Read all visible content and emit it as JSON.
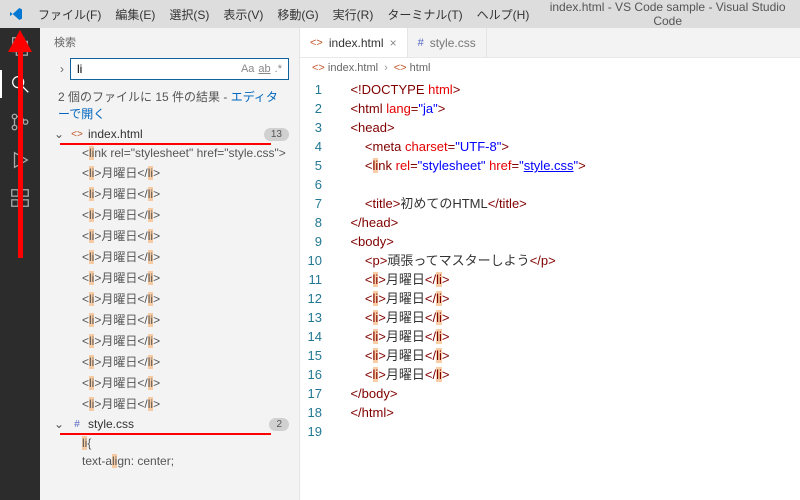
{
  "titlebar": {
    "menus": [
      "ファイル(F)",
      "編集(E)",
      "選択(S)",
      "表示(V)",
      "移動(G)",
      "実行(R)",
      "ターミナル(T)",
      "ヘルプ(H)"
    ],
    "title": "index.html - VS Code sample - Visual Studio Code"
  },
  "sidebar": {
    "header": "検索",
    "search_value": "li",
    "search_opts": {
      "case": "Aa",
      "word": "ab",
      "regex": ".*"
    },
    "summary_prefix": "2 個のファイルに 15 件の結果 - ",
    "summary_link": "エディターで開く",
    "files": [
      {
        "name": "index.html",
        "icon": "<>",
        "icon_class": "fic-html",
        "count": "13",
        "lines": [
          [
            [
              "<"
            ],
            [
              "li",
              true
            ],
            [
              "nk rel=\"stylesheet\" href=\"style.css\">"
            ]
          ],
          [
            [
              "<"
            ],
            [
              "li",
              true
            ],
            [
              ">月曜日</"
            ],
            [
              "li",
              true
            ],
            [
              ">"
            ]
          ],
          [
            [
              "<"
            ],
            [
              "li",
              true
            ],
            [
              ">月曜日</"
            ],
            [
              "li",
              true
            ],
            [
              ">"
            ]
          ],
          [
            [
              "<"
            ],
            [
              "li",
              true
            ],
            [
              ">月曜日</"
            ],
            [
              "li",
              true
            ],
            [
              ">"
            ]
          ],
          [
            [
              "<"
            ],
            [
              "li",
              true
            ],
            [
              ">月曜日</"
            ],
            [
              "li",
              true
            ],
            [
              ">"
            ]
          ],
          [
            [
              "<"
            ],
            [
              "li",
              true
            ],
            [
              ">月曜日</"
            ],
            [
              "li",
              true
            ],
            [
              ">"
            ]
          ],
          [
            [
              "<"
            ],
            [
              "li",
              true
            ],
            [
              ">月曜日</"
            ],
            [
              "li",
              true
            ],
            [
              ">"
            ]
          ],
          [
            [
              "<"
            ],
            [
              "li",
              true
            ],
            [
              ">月曜日</"
            ],
            [
              "li",
              true
            ],
            [
              ">"
            ]
          ],
          [
            [
              "<"
            ],
            [
              "li",
              true
            ],
            [
              ">月曜日</"
            ],
            [
              "li",
              true
            ],
            [
              ">"
            ]
          ],
          [
            [
              "<"
            ],
            [
              "li",
              true
            ],
            [
              ">月曜日</"
            ],
            [
              "li",
              true
            ],
            [
              ">"
            ]
          ],
          [
            [
              "<"
            ],
            [
              "li",
              true
            ],
            [
              ">月曜日</"
            ],
            [
              "li",
              true
            ],
            [
              ">"
            ]
          ],
          [
            [
              "<"
            ],
            [
              "li",
              true
            ],
            [
              ">月曜日</"
            ],
            [
              "li",
              true
            ],
            [
              ">"
            ]
          ],
          [
            [
              "<"
            ],
            [
              "li",
              true
            ],
            [
              ">月曜日</"
            ],
            [
              "li",
              true
            ],
            [
              ">"
            ]
          ]
        ]
      },
      {
        "name": "style.css",
        "icon": "#",
        "icon_class": "fic-css",
        "count": "2",
        "lines": [
          [
            [
              "li",
              true
            ],
            [
              "{"
            ]
          ],
          [
            [
              "text-a"
            ],
            [
              "li",
              true
            ],
            [
              "gn: center;"
            ]
          ]
        ]
      }
    ]
  },
  "editor": {
    "tabs": [
      {
        "icon": "<>",
        "icon_class": "fic-html",
        "label": "index.html",
        "active": true,
        "close": "×"
      },
      {
        "icon": "#",
        "icon_class": "fic-css",
        "label": "style.css",
        "active": false,
        "close": ""
      }
    ],
    "crumbs": [
      {
        "icon": "<>",
        "icon_class": "fic-html",
        "label": "index.html"
      },
      {
        "icon": "<>",
        "icon_class": "fic-html",
        "label": "html"
      }
    ],
    "lines": [
      {
        "n": 1,
        "ind": 1,
        "seg": [
          [
            "doct",
            "<!DOCTYPE "
          ],
          [
            "attn",
            "html"
          ],
          [
            "doct",
            ">"
          ]
        ]
      },
      {
        "n": 2,
        "ind": 1,
        "seg": [
          [
            "pun",
            "<"
          ],
          [
            "tag",
            "html "
          ],
          [
            "attn",
            "lang"
          ],
          [
            "pun",
            "="
          ],
          [
            "attv",
            "\"ja\""
          ],
          [
            "pun",
            ">"
          ]
        ]
      },
      {
        "n": 3,
        "ind": 1,
        "seg": [
          [
            "pun",
            "<"
          ],
          [
            "tag",
            "head"
          ],
          [
            "pun",
            ">"
          ]
        ]
      },
      {
        "n": 4,
        "ind": 2,
        "seg": [
          [
            "pun",
            "<"
          ],
          [
            "tag",
            "meta "
          ],
          [
            "attn",
            "charset"
          ],
          [
            "pun",
            "="
          ],
          [
            "attv",
            "\"UTF-8\""
          ],
          [
            "pun",
            ">"
          ]
        ]
      },
      {
        "n": 5,
        "ind": 2,
        "seg": [
          [
            "pun",
            "<"
          ],
          [
            "tag hlc",
            "li"
          ],
          [
            "tag",
            "nk "
          ],
          [
            "attn",
            "rel"
          ],
          [
            "pun",
            "="
          ],
          [
            "attv",
            "\"stylesheet\""
          ],
          [
            "",
            " "
          ],
          [
            "attn",
            "href"
          ],
          [
            "pun",
            "="
          ],
          [
            "attv",
            "\""
          ],
          [
            "attv link",
            "style.css"
          ],
          [
            "attv",
            "\""
          ],
          [
            "pun",
            ">"
          ]
        ]
      },
      {
        "n": 6,
        "ind": 0,
        "seg": []
      },
      {
        "n": 7,
        "ind": 2,
        "seg": [
          [
            "pun",
            "<"
          ],
          [
            "tag",
            "title"
          ],
          [
            "pun",
            ">"
          ],
          [
            "",
            "初めてのHTML"
          ],
          [
            "pun",
            "</"
          ],
          [
            "tag",
            "title"
          ],
          [
            "pun",
            ">"
          ]
        ]
      },
      {
        "n": 8,
        "ind": 1,
        "seg": [
          [
            "pun",
            "</"
          ],
          [
            "tag",
            "head"
          ],
          [
            "pun",
            ">"
          ]
        ]
      },
      {
        "n": 9,
        "ind": 1,
        "seg": [
          [
            "pun",
            "<"
          ],
          [
            "tag",
            "body"
          ],
          [
            "pun",
            ">"
          ]
        ]
      },
      {
        "n": 10,
        "ind": 2,
        "seg": [
          [
            "pun",
            "<"
          ],
          [
            "tag",
            "p"
          ],
          [
            "pun",
            ">"
          ],
          [
            "",
            "頑張ってマスターしよう"
          ],
          [
            "pun",
            "</"
          ],
          [
            "tag",
            "p"
          ],
          [
            "pun",
            ">"
          ]
        ]
      },
      {
        "n": 11,
        "ind": 2,
        "seg": [
          [
            "pun",
            "<"
          ],
          [
            "tag hlc",
            "li"
          ],
          [
            "pun",
            ">"
          ],
          [
            "",
            "月曜日"
          ],
          [
            "pun",
            "</"
          ],
          [
            "tag hlc",
            "li"
          ],
          [
            "pun",
            ">"
          ]
        ]
      },
      {
        "n": 12,
        "ind": 2,
        "seg": [
          [
            "pun",
            "<"
          ],
          [
            "tag hlc",
            "li"
          ],
          [
            "pun",
            ">"
          ],
          [
            "",
            "月曜日"
          ],
          [
            "pun",
            "</"
          ],
          [
            "tag hlc",
            "li"
          ],
          [
            "pun",
            ">"
          ]
        ]
      },
      {
        "n": 13,
        "ind": 2,
        "seg": [
          [
            "pun",
            "<"
          ],
          [
            "tag hlc",
            "li"
          ],
          [
            "pun",
            ">"
          ],
          [
            "",
            "月曜日"
          ],
          [
            "pun",
            "</"
          ],
          [
            "tag hlc",
            "li"
          ],
          [
            "pun",
            ">"
          ]
        ]
      },
      {
        "n": 14,
        "ind": 2,
        "seg": [
          [
            "pun",
            "<"
          ],
          [
            "tag hlc",
            "li"
          ],
          [
            "pun",
            ">"
          ],
          [
            "",
            "月曜日"
          ],
          [
            "pun",
            "</"
          ],
          [
            "tag hlc",
            "li"
          ],
          [
            "pun",
            ">"
          ]
        ]
      },
      {
        "n": 15,
        "ind": 2,
        "seg": [
          [
            "pun",
            "<"
          ],
          [
            "tag hlc",
            "li"
          ],
          [
            "pun",
            ">"
          ],
          [
            "",
            "月曜日"
          ],
          [
            "pun",
            "</"
          ],
          [
            "tag hlc",
            "li"
          ],
          [
            "pun",
            ">"
          ]
        ]
      },
      {
        "n": 16,
        "ind": 2,
        "seg": [
          [
            "pun",
            "<"
          ],
          [
            "tag hlc",
            "li"
          ],
          [
            "pun",
            ">"
          ],
          [
            "",
            "月曜日"
          ],
          [
            "pun",
            "</"
          ],
          [
            "tag hlc",
            "li"
          ],
          [
            "pun",
            ">"
          ]
        ]
      },
      {
        "n": 17,
        "ind": 1,
        "seg": [
          [
            "pun",
            "</"
          ],
          [
            "tag",
            "body"
          ],
          [
            "pun",
            ">"
          ]
        ]
      },
      {
        "n": 18,
        "ind": 1,
        "seg": [
          [
            "pun",
            "</"
          ],
          [
            "tag",
            "html"
          ],
          [
            "pun",
            ">"
          ]
        ]
      },
      {
        "n": 19,
        "ind": 0,
        "seg": []
      }
    ]
  }
}
